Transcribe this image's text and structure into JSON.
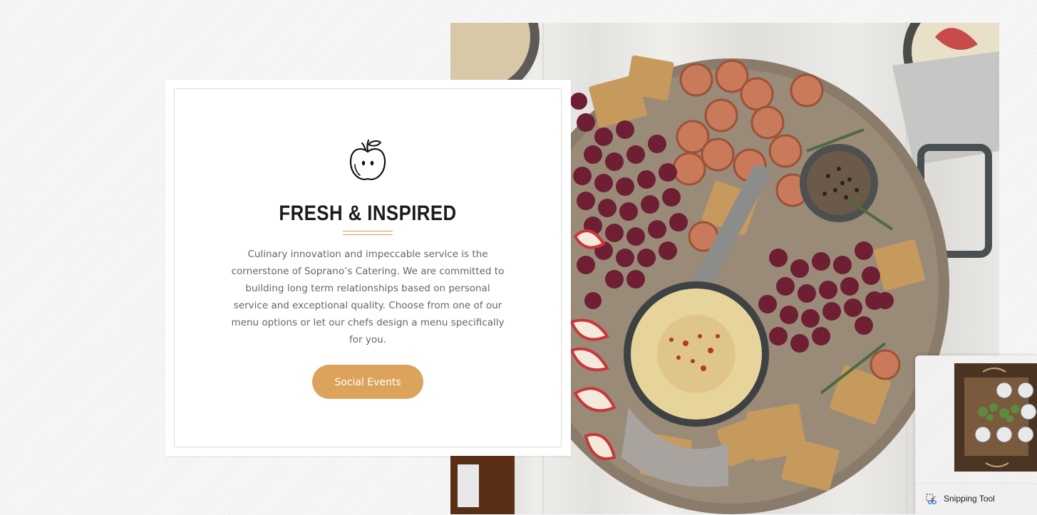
{
  "hero": {
    "heading": "FRESH & INSPIRED",
    "description": "Culinary innovation and impeccable service is the cornerstone of Soprano’s Catering. We are committed to building long term relationships based on personal service and exceptional quality. Choose from one of our menu options or let our chefs design a menu specifically for you.",
    "button_label": "Social Events",
    "icon": "apple-icon",
    "image": "charcuterie-board-photo"
  },
  "snipping_tool": {
    "label": "Snipping Tool",
    "icon": "snipping-tool-icon",
    "thumbnail": "dining-table-thumbnail"
  },
  "colors": {
    "accent": "#dca35c",
    "heading": "#1c1c1c",
    "body_text": "#666666"
  }
}
